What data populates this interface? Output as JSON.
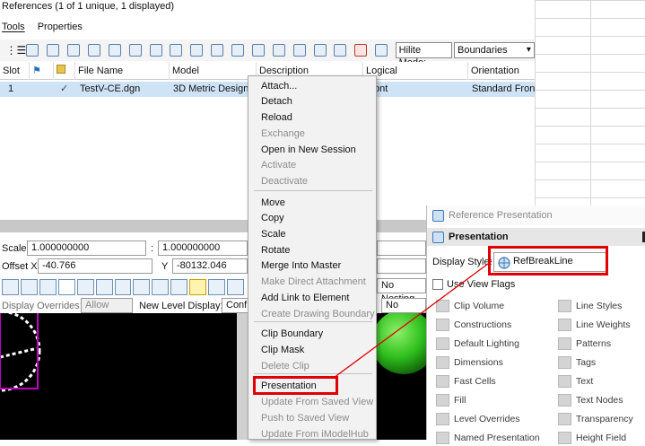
{
  "window": {
    "title": "References (1 of 1 unique, 1 displayed)"
  },
  "menu": {
    "tools": "Tools",
    "properties": "Properties"
  },
  "toolbar": {
    "hilite_mode_label": "Hilite Mode:",
    "hilite_mode_value": "Boundaries"
  },
  "table": {
    "columns": [
      "Slot",
      "",
      "",
      "File Name",
      "Model",
      "Description",
      "Logical",
      "Orientation"
    ],
    "row": {
      "slot": "1",
      "check": "✓",
      "file_name": "TestV-CE.dgn",
      "model": "3D Metric Design",
      "logical": "ont",
      "orientation": "Standard Front"
    }
  },
  "props": {
    "scale_label": "Scale",
    "scale_value_1": "1.000000000",
    "colon": ":",
    "scale_value_2": "1.000000000",
    "offset_x_label": "Offset X",
    "offset_x_value": "-40.766",
    "y_label": "Y",
    "y_value": "-80132.046",
    "nesting_label": "No Nesting",
    "display_overrides_label": "Display Overrides:",
    "display_overrides_value": "Allow",
    "new_level_display_label": "New Level Display:",
    "new_level_display_value": "Confi",
    "no_value": "No"
  },
  "context_menu": {
    "items": [
      {
        "label": "Attach...",
        "enabled": true
      },
      {
        "label": "Detach",
        "enabled": true
      },
      {
        "label": "Reload",
        "enabled": true
      },
      {
        "label": "Exchange",
        "enabled": false
      },
      {
        "label": "Open in New Session",
        "enabled": true
      },
      {
        "label": "Activate",
        "enabled": false
      },
      {
        "label": "Deactivate",
        "enabled": false
      },
      {
        "label": "Move",
        "enabled": true
      },
      {
        "label": "Copy",
        "enabled": true
      },
      {
        "label": "Scale",
        "enabled": true
      },
      {
        "label": "Rotate",
        "enabled": true
      },
      {
        "label": "Merge Into Master",
        "enabled": true
      },
      {
        "label": "Make Direct Attachment",
        "enabled": false
      },
      {
        "label": "Add Link to Element",
        "enabled": true
      },
      {
        "label": "Create Drawing Boundary",
        "enabled": false
      },
      {
        "label": "Clip Boundary",
        "enabled": true
      },
      {
        "label": "Clip Mask",
        "enabled": true
      },
      {
        "label": "Delete Clip",
        "enabled": false
      },
      {
        "label": "Presentation",
        "enabled": true
      },
      {
        "label": "Update From Saved View",
        "enabled": false
      },
      {
        "label": "Push to Saved View",
        "enabled": false
      },
      {
        "label": "Update From iModelHub",
        "enabled": false
      }
    ]
  },
  "panel": {
    "title": "Reference Presentation",
    "section": "Presentation",
    "display_style_label": "Display Style:",
    "display_style_value": "RefBreakLine",
    "use_view_flags": "Use View Flags",
    "left_options": [
      "Clip Volume",
      "Constructions",
      "Default Lighting",
      "Dimensions",
      "Fast Cells",
      "Fill",
      "Level Overrides",
      "Named Presentation"
    ],
    "right_options": [
      "Line Styles",
      "Line Weights",
      "Patterns",
      "Tags",
      "Text",
      "Text Nodes",
      "Transparency",
      "Height Field"
    ]
  },
  "colors": {
    "highlight_red": "#e00000",
    "row_selected": "#cfe3f7",
    "green_sphere": "#2fbf1e"
  }
}
